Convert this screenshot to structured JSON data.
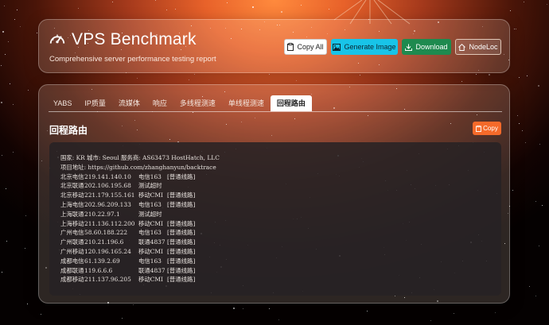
{
  "header": {
    "title": "VPS Benchmark",
    "subtitle": "Comprehensive server performance testing report",
    "buttons": {
      "copy_all": "Copy All",
      "generate_image": "Generate Image",
      "download": "Download",
      "nodeloc": "NodeLoc"
    }
  },
  "tabs": [
    "YABS",
    "IP质量",
    "流媒体",
    "响应",
    "多线程测速",
    "单线程测速",
    "回程路由"
  ],
  "active_tab": "回程路由",
  "section": {
    "title": "回程路由",
    "copy_label": "Copy"
  },
  "terminal": {
    "info_line": "国家: KR 城市: Seoul 服务商: AS63473 HostHatch, LLC",
    "project_line": "项目地址: https://github.com/zhanghanyun/backtrace",
    "routes": [
      {
        "loc": "北京电信",
        "ip": "219.141.140.10",
        "carrier": "电信163",
        "tag": "[普通线路]"
      },
      {
        "loc": "北京联通",
        "ip": "202.106.195.68",
        "carrier": "测试超时",
        "tag": ""
      },
      {
        "loc": "北京移动",
        "ip": "221.179.155.161",
        "carrier": "移动CMI",
        "tag": "[普通线路]"
      },
      {
        "loc": "上海电信",
        "ip": "202.96.209.133",
        "carrier": "电信163",
        "tag": "[普通线路]"
      },
      {
        "loc": "上海联通",
        "ip": "210.22.97.1",
        "carrier": "测试超时",
        "tag": ""
      },
      {
        "loc": "上海移动",
        "ip": "211.136.112.200",
        "carrier": "移动CMI",
        "tag": "[普通线路]"
      },
      {
        "loc": "广州电信",
        "ip": "58.60.188.222",
        "carrier": "电信163",
        "tag": "[普通线路]"
      },
      {
        "loc": "广州联通",
        "ip": "210.21.196.6",
        "carrier": "联通4837",
        "tag": "[普通线路]"
      },
      {
        "loc": "广州移动",
        "ip": "120.196.165.24",
        "carrier": "移动CMI",
        "tag": "[普通线路]"
      },
      {
        "loc": "成都电信",
        "ip": "61.139.2.69",
        "carrier": "电信163",
        "tag": "[普通线路]"
      },
      {
        "loc": "成都联通",
        "ip": "119.6.6.6",
        "carrier": "联通4837",
        "tag": "[普通线路]"
      },
      {
        "loc": "成都移动",
        "ip": "211.137.96.205",
        "carrier": "移动CMI",
        "tag": "[普通线路]"
      }
    ]
  },
  "colors": {
    "accent_orange": "#f56a2a",
    "generate_image_bg": "#18c4e8",
    "download_bg": "#1e8a4f",
    "terminal_bg": "#262224"
  },
  "icons": {
    "title": "speedometer-icon",
    "copy_all": "clipboard-icon",
    "generate_image": "image-icon",
    "download": "download-icon",
    "nodeloc": "home-icon",
    "copy": "clipboard-icon"
  }
}
